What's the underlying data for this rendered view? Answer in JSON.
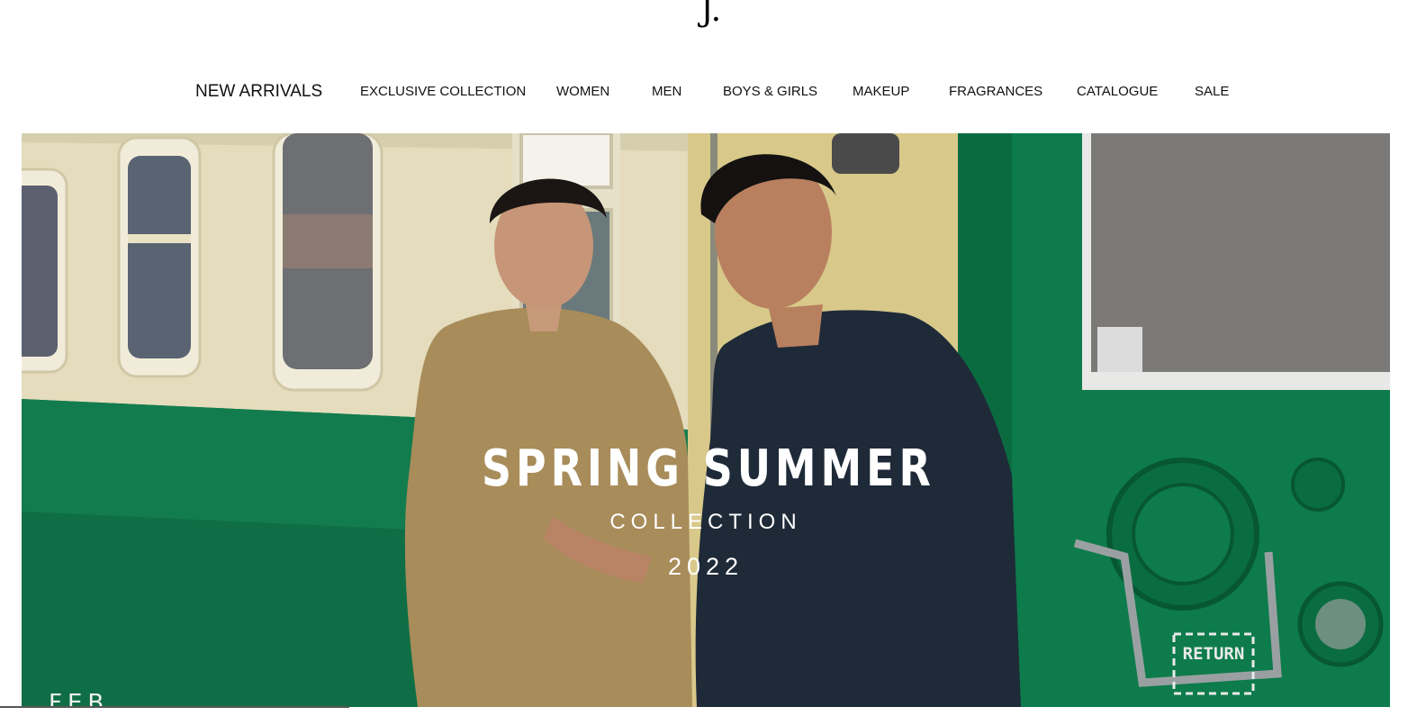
{
  "brand": {
    "logo_text": "J."
  },
  "nav": {
    "items": [
      {
        "label": "NEW ARRIVALS"
      },
      {
        "label": "EXCLUSIVE COLLECTION"
      },
      {
        "label": "WOMEN"
      },
      {
        "label": "MEN"
      },
      {
        "label": "BOYS & GIRLS"
      },
      {
        "label": "MAKEUP"
      },
      {
        "label": "FRAGRANCES"
      },
      {
        "label": "CATALOGUE"
      },
      {
        "label": "SALE"
      }
    ]
  },
  "hero": {
    "title": "SPRING SUMMER",
    "subtitle": "COLLECTION",
    "year": "2022",
    "stamp_text": "RETURN",
    "bottom_fragment": "FEB"
  },
  "colors": {
    "train_green": "#0e7a4c",
    "train_cream": "#e9e2c4",
    "kurta_tan": "#a88c5a",
    "kurta_navy": "#1f2a38"
  }
}
